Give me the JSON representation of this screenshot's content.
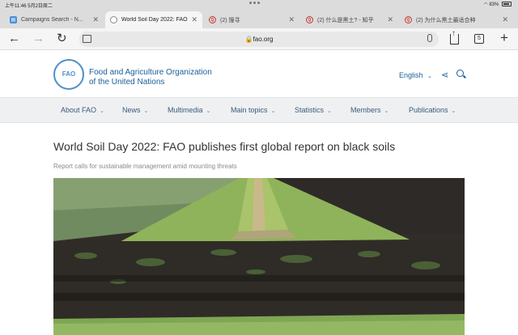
{
  "status_bar": {
    "time_date": "上午11:46  5月2日周二",
    "battery": "83%"
  },
  "tabs": [
    {
      "title": "Campaigns Search - N...",
      "icon": "campaign-icon",
      "active": false
    },
    {
      "title": "World Soil Day 2022: FAO",
      "icon": "globe-icon",
      "active": true
    },
    {
      "title": "(2) 搜寻",
      "icon": "zhihu-icon",
      "active": false
    },
    {
      "title": "(2) 什么是黑土? - 知乎",
      "icon": "zhihu-icon",
      "active": false
    },
    {
      "title": "(2) 为什么黑土最适合种",
      "icon": "zhihu-icon",
      "active": false
    }
  ],
  "address_bar": {
    "url": "fao.org",
    "tab_count": "5"
  },
  "site": {
    "org_line1": "Food and Agriculture Organization",
    "org_line2": "of the United Nations",
    "logo_text": "FAO",
    "language": "English"
  },
  "nav": [
    "About FAO",
    "News",
    "Multimedia",
    "Main topics",
    "Statistics",
    "Members",
    "Publications"
  ],
  "article": {
    "headline": "World Soil Day 2022: FAO publishes first global report on black soils",
    "subheadline": "Report calls for sustainable management amid mounting threats"
  },
  "colors": {
    "brand_blue": "#1a5e9a",
    "logo_blue": "#4f8fc9",
    "nav_bg": "#eef0f2"
  }
}
